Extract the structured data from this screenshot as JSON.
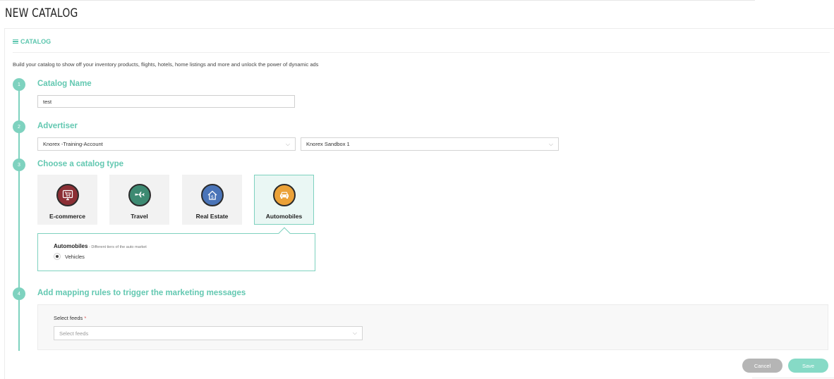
{
  "page": {
    "title": "NEW CATALOG"
  },
  "section": {
    "header": "CATALOG",
    "intro": "Build your catalog to show off your inventory products, flights, hotels, home listings and more and unlock the power of dynamic ads"
  },
  "steps": [
    {
      "number": "1",
      "title": "Catalog Name"
    },
    {
      "number": "2",
      "title": "Advertiser"
    },
    {
      "number": "3",
      "title": "Choose a catalog type"
    },
    {
      "number": "4",
      "title": "Add mapping rules to trigger the marketing messages"
    }
  ],
  "catalog_name": {
    "value": "test"
  },
  "advertiser": {
    "account": "Knorex -Training-Account",
    "sandbox": "Knorex Sandbox 1"
  },
  "catalog_types": [
    {
      "label": "E-commerce",
      "icon": "shopping-cart-monitor-icon",
      "color": "#8c2f35"
    },
    {
      "label": "Travel",
      "icon": "airplane-icon",
      "color": "#3d8a72"
    },
    {
      "label": "Real Estate",
      "icon": "house-dollar-icon",
      "color": "#4a74b8"
    },
    {
      "label": "Automobiles",
      "icon": "car-icon",
      "color": "#eba238"
    }
  ],
  "selected_type": {
    "title": "Automobiles",
    "description": " - Different tiers of the auto market",
    "option": "Vehicles"
  },
  "mapping": {
    "feeds_label": "Select feeds",
    "required_mark": " *",
    "feeds_placeholder": "Select feeds"
  },
  "actions": {
    "cancel": "Cancel",
    "save": "Save"
  }
}
